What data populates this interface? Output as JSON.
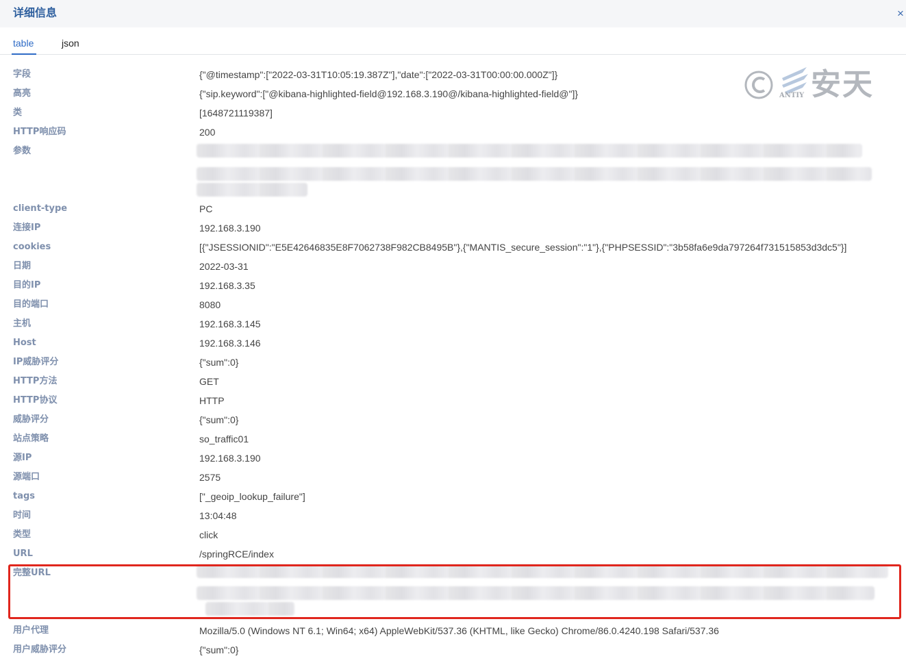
{
  "dialog": {
    "title": "详细信息",
    "close_icon": "×"
  },
  "tabs": [
    {
      "label": "table",
      "active": true
    },
    {
      "label": "json",
      "active": false
    }
  ],
  "watermark": {
    "symbol": "©",
    "text": "安天",
    "small": "ANTIY"
  },
  "fields": [
    {
      "key": "字段",
      "value": "{\"@timestamp\":[\"2022-03-31T10:05:19.387Z\"],\"date\":[\"2022-03-31T00:00:00.000Z\"]}"
    },
    {
      "key": "高亮",
      "value": "{\"sip.keyword\":[\"@kibana-highlighted-field@192.168.3.190@/kibana-highlighted-field@\"]}"
    },
    {
      "key": "类",
      "value": "[1648721119387]"
    },
    {
      "key": "HTTP响应码",
      "value": "200"
    },
    {
      "key": "参数",
      "value": ""
    },
    {
      "key": "client-type",
      "value": "PC"
    },
    {
      "key": "连接IP",
      "value": "192.168.3.190"
    },
    {
      "key": "cookies",
      "value": "[{\"JSESSIONID\":\"E5E42646835E8F7062738F982CB8495B\"},{\"MANTIS_secure_session\":\"1\"},{\"PHPSESSID\":\"3b58fa6e9da797264f731515853d3dc5\"}]"
    },
    {
      "key": "日期",
      "value": "2022-03-31"
    },
    {
      "key": "目的IP",
      "value": "192.168.3.35"
    },
    {
      "key": "目的端口",
      "value": "8080"
    },
    {
      "key": "主机",
      "value": "192.168.3.145"
    },
    {
      "key": "Host",
      "value": "192.168.3.146"
    },
    {
      "key": "IP威胁评分",
      "value": "{\"sum\":0}"
    },
    {
      "key": "HTTP方法",
      "value": "GET"
    },
    {
      "key": "HTTP协议",
      "value": "HTTP"
    },
    {
      "key": "威胁评分",
      "value": "{\"sum\":0}"
    },
    {
      "key": "站点策略",
      "value": "so_traffic01"
    },
    {
      "key": "源IP",
      "value": "192.168.3.190"
    },
    {
      "key": "源端口",
      "value": "2575"
    },
    {
      "key": "tags",
      "value": "[\"_geoip_lookup_failure\"]"
    },
    {
      "key": "时间",
      "value": "13:04:48"
    },
    {
      "key": "类型",
      "value": "click"
    },
    {
      "key": "URL",
      "value": "/springRCE/index"
    },
    {
      "key": "完整URL",
      "value": ""
    },
    {
      "key": "用户代理",
      "value": "Mozilla/5.0 (Windows NT 6.1; Win64; x64) AppleWebKit/537.36 (KHTML, like Gecko) Chrome/86.0.4240.198 Safari/537.36"
    },
    {
      "key": "用户威胁评分",
      "value": "{\"sum\":0}"
    }
  ]
}
